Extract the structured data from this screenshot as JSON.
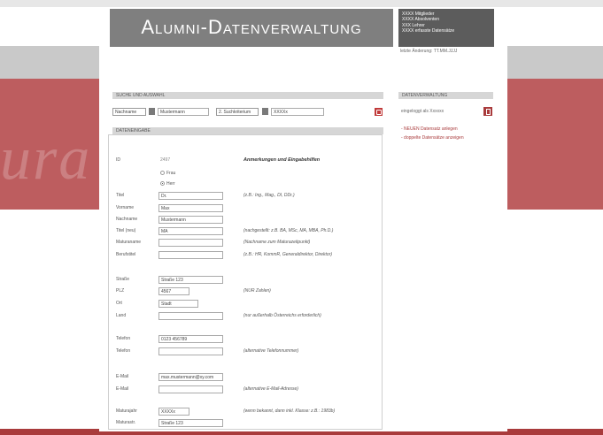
{
  "header": {
    "title": "Alumni-Datenverwaltung",
    "stats": [
      "XXXX  Mitglieder",
      "XXXX  Absolventen",
      "  XXX  Lehrer",
      "XXXX  erfasste Datensätze"
    ],
    "last_change": "letzte Änderung: TT.MM.JJJJ"
  },
  "watermark": "ura alumni",
  "search": {
    "section_label": "Suche und Auswahl",
    "select1": "Nachname",
    "input1": "Mustermann",
    "select2": "2. Suchkriterium",
    "input2": "XXXXx"
  },
  "sidebar": {
    "section_label": "Datenverwaltung",
    "logged_in": "eingeloggt als Xxxxxx",
    "links": [
      "- NEUEN Datensatz anlegen",
      "- doppelte Datensätze anzeigen"
    ]
  },
  "form": {
    "section_label": "Dateneingabe",
    "id_label": "ID",
    "id_value": "2497",
    "notes_heading": "Anmerkungen und Eingabehilfen",
    "gender_options": [
      "Frau",
      "Herr"
    ],
    "gender_selected": "Herr",
    "fields": [
      {
        "label": "Titel",
        "value": "Dr.",
        "note": "(z.B.: Ing., Mag., DI, DDr.)"
      },
      {
        "label": "Vorname",
        "value": "Max",
        "note": ""
      },
      {
        "label": "Nachname",
        "value": "Mustermann",
        "note": ""
      },
      {
        "label": "Titel (neu)",
        "value": "MA",
        "note": "(nachgestellt: z.B. BA, MSc, MA, MBA, Ph.D.)"
      },
      {
        "label": "Maturaname",
        "value": "",
        "note": "(Nachname zum Maturazeitpunkt)"
      },
      {
        "label": "Berufstitel",
        "value": "",
        "note": "(z.B.: HR, KommR, Generaldirektor, Direktor)"
      },
      {
        "label": "Straße",
        "value": "Straße 123",
        "note": ""
      },
      {
        "label": "PLZ",
        "value": "4567",
        "note": "(NUR Zahlen)"
      },
      {
        "label": "Ort",
        "value": "Stadt",
        "note": ""
      },
      {
        "label": "Land",
        "value": "",
        "note": "(nur außerhalb Österreichs erforderlich)"
      },
      {
        "label": "Telefon",
        "value": "0123 456789",
        "note": ""
      },
      {
        "label": "Telefon",
        "value": "",
        "note": "(alternative Telefonnummer)"
      },
      {
        "label": "E-Mail",
        "value": "max.mustermann@xy.com",
        "note": ""
      },
      {
        "label": "E-Mail",
        "value": "",
        "note": "(alternative E-Mail-Adresse)"
      },
      {
        "label": "Maturajahr",
        "value": "XXXXx",
        "note": "(wenn bekannt, dann inkl. Klasse: z.B.: 1983b)"
      },
      {
        "label": "Maturastr.",
        "value": "Straße 123",
        "note": ""
      }
    ]
  },
  "colors": {
    "accent_red": "#a93b3c",
    "band_red": "#bd5d5f",
    "header_grey": "#7f7f7f"
  }
}
